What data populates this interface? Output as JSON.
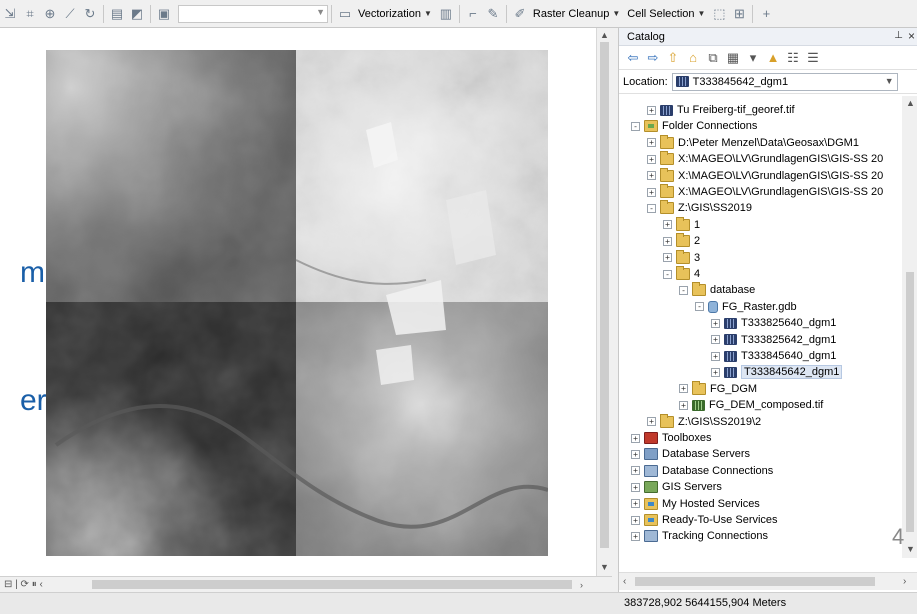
{
  "toolbar": {
    "vectorization_label": "Vectorization",
    "raster_cleanup_label": "Raster Cleanup",
    "cell_selection_label": "Cell Selection"
  },
  "slide_fragments": [
    "m",
    "er"
  ],
  "catalog": {
    "title": "Catalog",
    "location_label": "Location:",
    "location_value": "T333845642_dgm1",
    "items": [
      {
        "label": "Tu Freiberg-tif_georef.tif",
        "icon": "raster-icon"
      },
      {
        "label": "Folder Connections",
        "icon": "folder-connection-icon"
      },
      {
        "label": "D:\\Peter Menzel\\Data\\Geosax\\DGM1",
        "icon": "folder-icon"
      },
      {
        "label": "X:\\MAGEO\\LV\\GrundlagenGIS\\GIS-SS 20",
        "icon": "folder-icon"
      },
      {
        "label": "X:\\MAGEO\\LV\\GrundlagenGIS\\GIS-SS 20",
        "icon": "folder-icon"
      },
      {
        "label": "X:\\MAGEO\\LV\\GrundlagenGIS\\GIS-SS 20",
        "icon": "folder-icon"
      },
      {
        "label": "Z:\\GIS\\SS2019",
        "icon": "folder-icon"
      },
      {
        "label": "1",
        "icon": "folder-icon"
      },
      {
        "label": "2",
        "icon": "folder-icon"
      },
      {
        "label": "3",
        "icon": "folder-icon"
      },
      {
        "label": "4",
        "icon": "folder-icon"
      },
      {
        "label": "database",
        "icon": "folder-icon"
      },
      {
        "label": "FG_Raster.gdb",
        "icon": "geodatabase-icon"
      },
      {
        "label": "T333825640_dgm1",
        "icon": "raster-icon"
      },
      {
        "label": "T333825642_dgm1",
        "icon": "raster-icon"
      },
      {
        "label": "T333845640_dgm1",
        "icon": "raster-icon"
      },
      {
        "label": "T333845642_dgm1",
        "icon": "raster-icon",
        "selected": true
      },
      {
        "label": "FG_DGM",
        "icon": "folder-icon"
      },
      {
        "label": "FG_DEM_composed.tif",
        "icon": "raster-icon"
      },
      {
        "label": "Z:\\GIS\\SS2019\\2",
        "icon": "folder-icon"
      },
      {
        "label": "Toolboxes",
        "icon": "toolbox-icon"
      },
      {
        "label": "Database Servers",
        "icon": "database-server-icon"
      },
      {
        "label": "Database Connections",
        "icon": "database-connection-icon"
      },
      {
        "label": "GIS Servers",
        "icon": "gis-server-icon"
      },
      {
        "label": "My Hosted Services",
        "icon": "hosted-services-icon"
      },
      {
        "label": "Ready-To-Use Services",
        "icon": "ready-services-icon"
      },
      {
        "label": "Tracking Connections",
        "icon": "tracking-connections-icon"
      }
    ]
  },
  "page_number": "4",
  "status": {
    "coordinates": "383728,902  5644155,904 Meters"
  }
}
